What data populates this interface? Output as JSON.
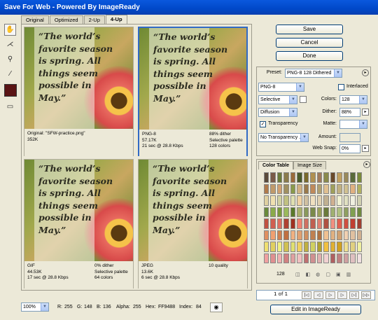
{
  "window": {
    "title": "Save For Web - Powered By ImageReady"
  },
  "tabs": [
    "Original",
    "Optimized",
    "2-Up",
    "4-Up"
  ],
  "active_tab": "4-Up",
  "quote": "“The world’s favorite season is spring. All things seem possible in May.”",
  "panes": [
    {
      "left": "Original: \"SFW-practice.png\"\n352K",
      "right": ""
    },
    {
      "left": "PNG-8\n57.17K\n21 sec @ 28.8 Kbps",
      "right": "88% dither\nSelective palette\n128 colors"
    },
    {
      "left": "GIF\n44.53K\n17 sec @ 28.8 Kbps",
      "right": "0% dither\nSelective palette\n64 colors"
    },
    {
      "left": "JPEG\n13.6K\n6 sec @ 28.8 Kbps",
      "right": "10 quality"
    }
  ],
  "buttons": {
    "save": "Save",
    "cancel": "Cancel",
    "done": "Done",
    "edit": "Edit in ImageReady"
  },
  "settings": {
    "preset_label": "Preset:",
    "preset": "PNG-8 128 Dithered",
    "format": "PNG-8",
    "interlaced": "Interlaced",
    "reduction": "Selective",
    "colors_label": "Colors:",
    "colors": "128",
    "dither_algo": "Diffusion",
    "dither_label": "Dither:",
    "dither": "88%",
    "transparency": "Transparency",
    "matte_label": "Matte:",
    "trans_dither": "No Transparency ...",
    "amount_label": "Amount:",
    "websnap_label": "Web Snap:",
    "websnap": "0%"
  },
  "color_table": {
    "tab1": "Color Table",
    "tab2": "Image Size",
    "count": "128"
  },
  "palette": [
    "#5a4a3a",
    "#7a5a48",
    "#6b7a3a",
    "#8a7a4a",
    "#9a6a3a",
    "#4a5a2a",
    "#7a6a2a",
    "#b09050",
    "#a07a5a",
    "#8a8a4a",
    "#6a4a2a",
    "#c0a060",
    "#9a8a5a",
    "#5a6a3a",
    "#7a8a3a",
    "#b07a4a",
    "#c09a6a",
    "#d0a070",
    "#a09060",
    "#8a9a4a",
    "#d0b080",
    "#9a7a4a",
    "#c08a5a",
    "#b0a070",
    "#e0c090",
    "#a0a05a",
    "#c0b080",
    "#d0c090",
    "#e0b080",
    "#b0b060",
    "#e0d0a0",
    "#f0e0b0",
    "#d0d0a0",
    "#c0c080",
    "#e0e0b0",
    "#f0d0a0",
    "#d0c0a0",
    "#f0e0c0",
    "#e0d0b0",
    "#c0b090",
    "#d0b090",
    "#f0f0d0",
    "#e0e0c0",
    "#f0f0e0",
    "#d0d0b0",
    "#6a8a3a",
    "#8aaa4a",
    "#7a9a3a",
    "#9aba5a",
    "#5a7a2a",
    "#aab06a",
    "#8a9a5a",
    "#7a8a4a",
    "#9aa05a",
    "#6a7a3a",
    "#a0b070",
    "#b0c080",
    "#90a060",
    "#80a050",
    "#708a40",
    "#c05040",
    "#d06050",
    "#e07060",
    "#b04030",
    "#a03020",
    "#f08070",
    "#d07060",
    "#c06050",
    "#e08070",
    "#b05040",
    "#f09080",
    "#e06050",
    "#d05040",
    "#c04030",
    "#a04030",
    "#e09060",
    "#f0a070",
    "#d08050",
    "#c07040",
    "#f0b080",
    "#e0a070",
    "#d09060",
    "#c08050",
    "#b07040",
    "#f0c090",
    "#e0b080",
    "#d0a070",
    "#f0d0b0",
    "#e0c0a0",
    "#d0b090",
    "#f0e070",
    "#e0d060",
    "#f0f080",
    "#d0c050",
    "#e0e070",
    "#f0d060",
    "#c0b040",
    "#d0d060",
    "#b0a030",
    "#f0c040",
    "#e0b030",
    "#d0a020",
    "#f0e090",
    "#e0d080",
    "#f0f0a0",
    "#f0a0a0",
    "#e09090",
    "#f0b0b0",
    "#d08080",
    "#e0a0a0",
    "#f0c0c0",
    "#c07070",
    "#d09090",
    "#e0b0b0",
    "#f0d0d0",
    "#b06060",
    "#c08080",
    "#d0a0a0",
    "#e0c0c0",
    "#f0e0e0"
  ],
  "page_nav": {
    "label": "1 of 1"
  },
  "status": {
    "zoom": "100%",
    "r_label": "R:",
    "r": "255",
    "g_label": "G:",
    "g": "148",
    "b_label": "B:",
    "b": "136",
    "alpha_label": "Alpha:",
    "alpha": "255",
    "hex_label": "Hex:",
    "hex": "FF9488",
    "index_label": "Index:",
    "index": "84"
  }
}
